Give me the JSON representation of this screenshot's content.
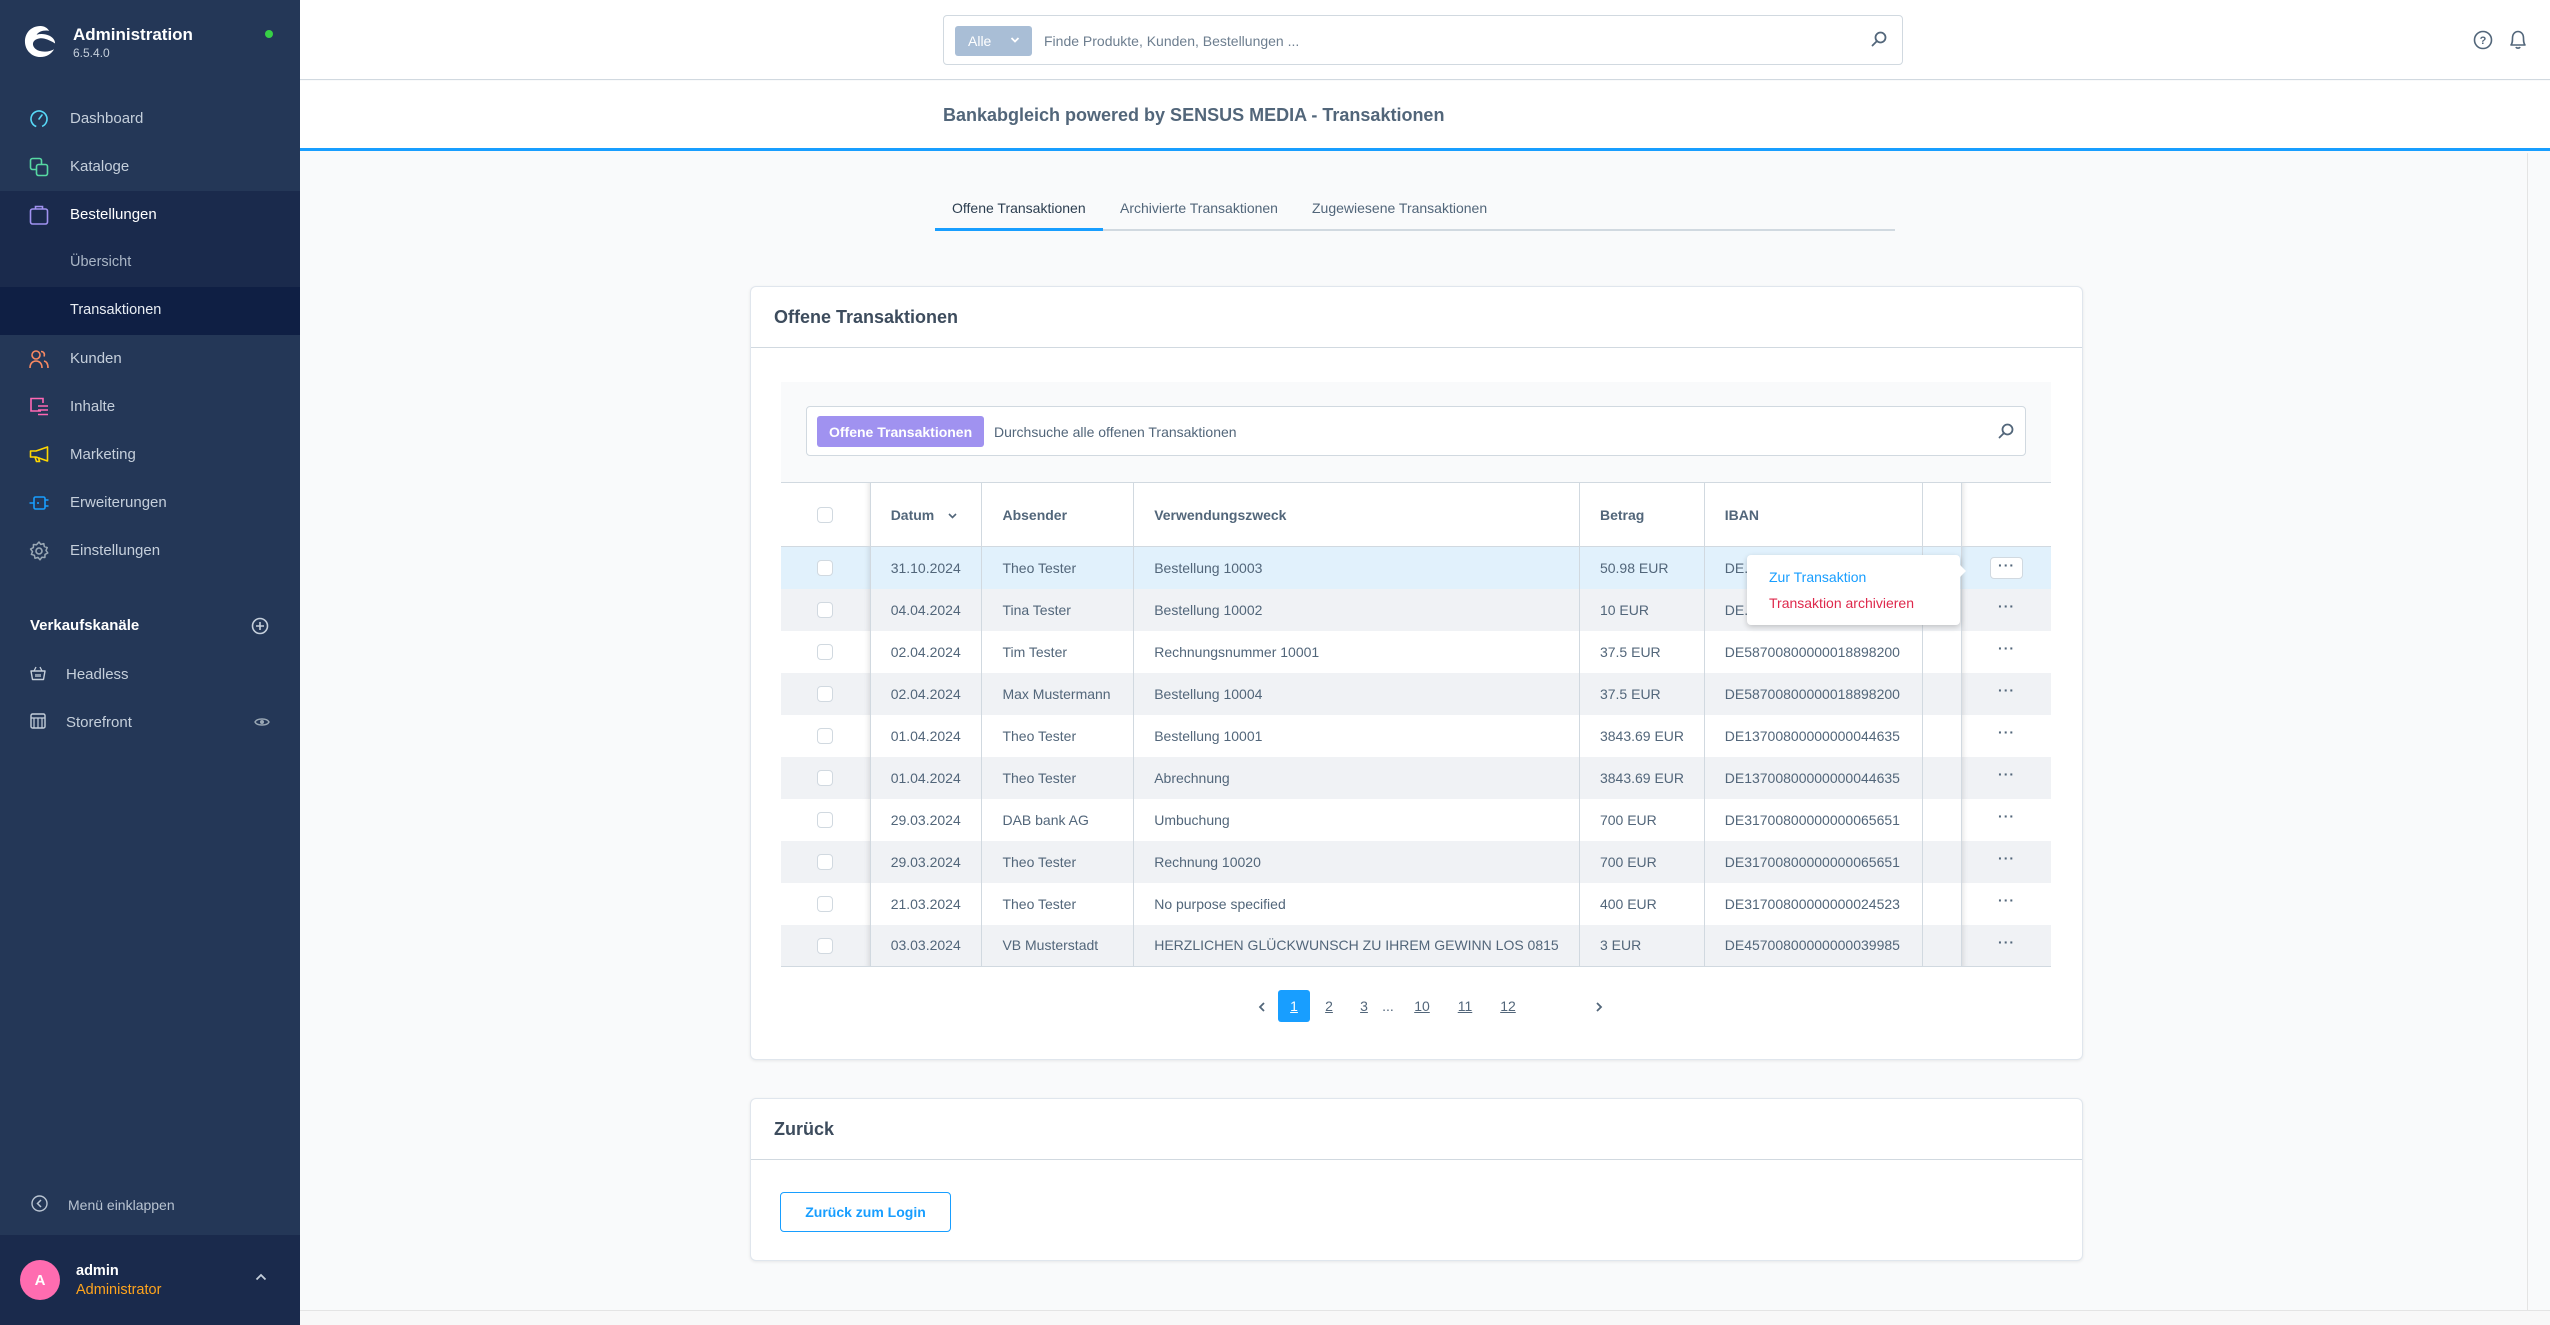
{
  "app": {
    "title": "Administration",
    "version": "6.5.4.0",
    "status_color": "#37d046"
  },
  "sidebar": {
    "items": [
      {
        "label": "Dashboard",
        "icon": "gauge-icon",
        "color": "#57d9f8"
      },
      {
        "label": "Kataloge",
        "icon": "catalog-icon",
        "color": "#57d9a3"
      },
      {
        "label": "Bestellungen",
        "icon": "shopping-bag-icon",
        "color": "#a092f0",
        "active": true
      },
      {
        "label": "Kunden",
        "icon": "users-icon",
        "color": "#f88962"
      },
      {
        "label": "Inhalte",
        "icon": "content-icon",
        "color": "#ff68b4"
      },
      {
        "label": "Marketing",
        "icon": "megaphone-icon",
        "color": "#ffd700"
      },
      {
        "label": "Erweiterungen",
        "icon": "plug-icon",
        "color": "#189eff"
      },
      {
        "label": "Einstellungen",
        "icon": "gear-icon",
        "color": "#9aa8b5"
      }
    ],
    "sub_items": [
      {
        "label": "Übersicht"
      },
      {
        "label": "Transaktionen",
        "active": true
      }
    ],
    "channels_title": "Verkaufskanäle",
    "channels": [
      {
        "label": "Headless",
        "icon": "basket-icon"
      },
      {
        "label": "Storefront",
        "icon": "storefront-icon",
        "visible_toggle": true
      }
    ],
    "collapse_label": "Menü einklappen",
    "user": {
      "initial": "A",
      "name": "admin",
      "role": "Administrator",
      "avatar_color": "#ff6cb0"
    }
  },
  "topbar": {
    "search_type": "Alle",
    "search_placeholder": "Finde Produkte, Kunden, Bestellungen ..."
  },
  "page": {
    "title": "Bankabgleich powered by SENSUS MEDIA - Transaktionen"
  },
  "tabs": [
    {
      "label": "Offene Transaktionen",
      "active": true
    },
    {
      "label": "Archivierte Transaktionen"
    },
    {
      "label": "Zugewiesene Transaktionen"
    }
  ],
  "transactions_card": {
    "title": "Offene Transaktionen",
    "search_badge": "Offene Transaktionen",
    "search_placeholder": "Durchsuche alle offenen Transaktionen",
    "columns": [
      "Datum",
      "Absender",
      "Verwendungszweck",
      "Betrag",
      "IBAN"
    ],
    "sorted_column": "Datum",
    "rows": [
      {
        "date": "31.10.2024",
        "sender": "Theo Tester",
        "purpose": "Bestellung 10003",
        "amount": "50.98 EUR",
        "iban": "DE..."
      },
      {
        "date": "04.04.2024",
        "sender": "Tina Tester",
        "purpose": "Bestellung 10002",
        "amount": "10 EUR",
        "iban": "DE..."
      },
      {
        "date": "02.04.2024",
        "sender": "Tim Tester",
        "purpose": "Rechnungsnummer 10001",
        "amount": "37.5 EUR",
        "iban": "DE58700800000018898200"
      },
      {
        "date": "02.04.2024",
        "sender": "Max Mustermann",
        "purpose": "Bestellung 10004",
        "amount": "37.5 EUR",
        "iban": "DE58700800000018898200"
      },
      {
        "date": "01.04.2024",
        "sender": "Theo Tester",
        "purpose": "Bestellung 10001",
        "amount": "3843.69 EUR",
        "iban": "DE13700800000000044635"
      },
      {
        "date": "01.04.2024",
        "sender": "Theo Tester",
        "purpose": "Abrechnung",
        "amount": "3843.69 EUR",
        "iban": "DE13700800000000044635"
      },
      {
        "date": "29.03.2024",
        "sender": "DAB bank AG",
        "purpose": "Umbuchung",
        "amount": "700 EUR",
        "iban": "DE31700800000000065651"
      },
      {
        "date": "29.03.2024",
        "sender": "Theo Tester",
        "purpose": "Rechnung 10020",
        "amount": "700 EUR",
        "iban": "DE31700800000000065651"
      },
      {
        "date": "21.03.2024",
        "sender": "Theo Tester",
        "purpose": "No purpose specified",
        "amount": "400 EUR",
        "iban": "DE31700800000000024523"
      },
      {
        "date": "03.03.2024",
        "sender": "VB Musterstadt",
        "purpose": "HERZLICHEN GLÜCKWUNSCH ZU IHREM GEWINN LOS 0815",
        "amount": "3 EUR",
        "iban": "DE45700800000000039985"
      }
    ],
    "context_menu": {
      "open_row": 0,
      "items": [
        {
          "label": "Zur Transaktion",
          "variant": "primary"
        },
        {
          "label": "Transaktion archivieren",
          "variant": "danger"
        }
      ]
    },
    "context_button_label": "···",
    "pagination": {
      "current": 1,
      "pages": [
        "1",
        "2",
        "3",
        "...",
        "10",
        "11",
        "12"
      ]
    }
  },
  "back_card": {
    "title": "Zurück",
    "button_label": "Zurück zum Login"
  },
  "colors": {
    "accent": "#189eff",
    "sidebar_bg": "#243757",
    "danger": "#de294c",
    "badge_purple": "#a092f0"
  }
}
